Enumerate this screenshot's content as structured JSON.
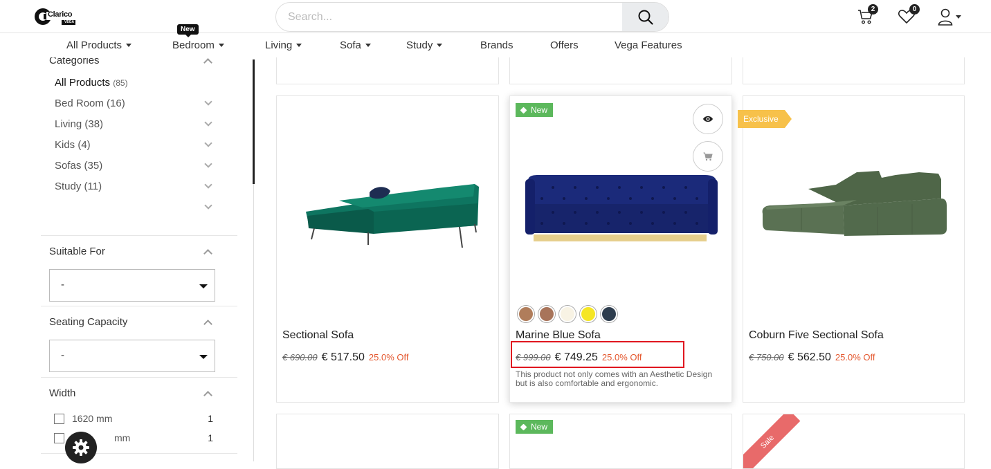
{
  "header": {
    "logo_text": "Clarico",
    "logo_sub": "VEGA",
    "search_placeholder": "Search...",
    "cart_count": "2",
    "wishlist_count": "0"
  },
  "nav": {
    "items": [
      "All Products",
      "Bedroom",
      "Living",
      "Sofa",
      "Study",
      "Brands",
      "Offers",
      "Vega Features"
    ],
    "new_badge": "New"
  },
  "sidebar": {
    "categories_title": "Categories",
    "categories": [
      {
        "label": "All Products",
        "count": "(85)"
      },
      {
        "label": "Bed Room (16)"
      },
      {
        "label": "Living (38)"
      },
      {
        "label": "Kids (4)"
      },
      {
        "label": "Sofas (35)"
      },
      {
        "label": "Study (11)"
      }
    ],
    "suitable_title": "Suitable For",
    "suitable_value": "-",
    "seating_title": "Seating Capacity",
    "seating_value": "-",
    "width_title": "Width",
    "width_options": [
      {
        "label": "1620 mm",
        "count": "1"
      },
      {
        "label": "mm",
        "count": "1"
      }
    ]
  },
  "products": [
    {
      "name": "Sectional Sofa",
      "old_price": "€ 690.00",
      "price": "€ 517.50",
      "off": "25.0% Off"
    },
    {
      "name": "Marine Blue Sofa",
      "old_price": "€ 999.00",
      "price": "€ 749.25",
      "off": "25.0% Off",
      "tag": "New",
      "description": "This product not only comes with an Aesthetic Design but is also comfortable and ergonomic.",
      "swatches": [
        "#b07d5b",
        "#a8745a",
        "#f8f3e4",
        "#f5e625",
        "#2e3d4e"
      ]
    },
    {
      "name": "Coburn Five Sectional Sofa",
      "old_price": "€ 750.00",
      "price": "€ 562.50",
      "off": "25.0% Off",
      "tag": "Exclusive"
    }
  ],
  "bottom_row": {
    "tag_new": "New",
    "ribbon_sale": "Sale"
  },
  "colors": {
    "green_tag": "#5cb85c",
    "exclusive_tag": "#f7c14a",
    "discount": "#e4572e",
    "highlight": "#e0161f"
  }
}
